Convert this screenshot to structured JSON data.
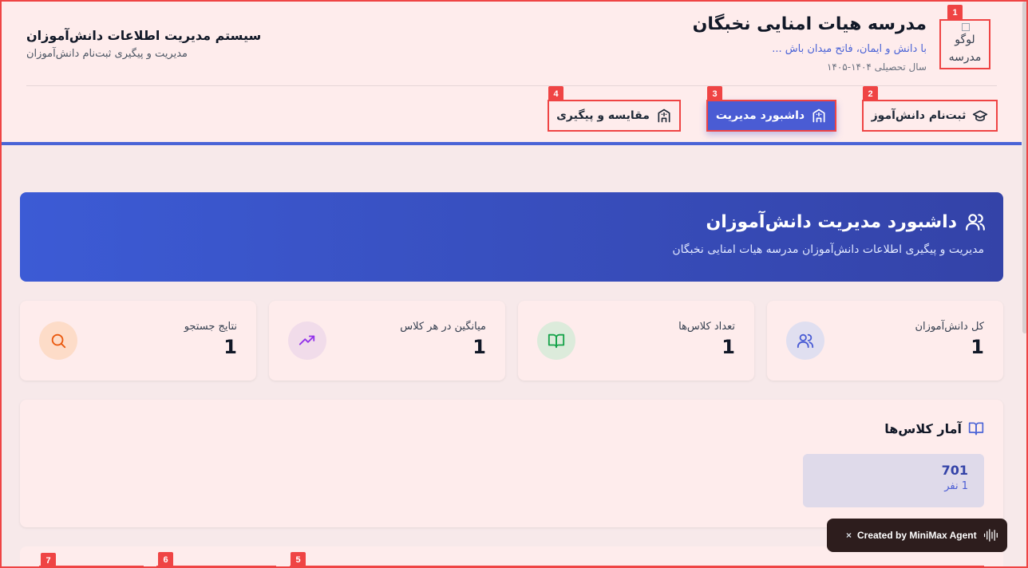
{
  "school": {
    "logo_alt": "لوگو مدرسه",
    "name": "مدرسه هیات امنایی نخبگان",
    "motto": "با دانش و ایمان، فاتح میدان باش ...",
    "year": "سال تحصیلی ۱۴۰۴-۱۴۰۵"
  },
  "system": {
    "title": "سیستم مدیریت اطلاعات دانش‌آموزان",
    "subtitle": "مدیریت و پیگیری ثبت‌نام دانش‌آموزان"
  },
  "nav": {
    "register": "ثبت‌نام دانش‌آموز",
    "dashboard": "داشبورد مدیریت",
    "compare": "مقایسه و پیگیری"
  },
  "banner": {
    "title": "داشبورد مدیریت دانش‌آموزان",
    "subtitle": "مدیریت و پیگیری اطلاعات دانش‌آموزان مدرسه هیات امنایی نخبگان"
  },
  "stats": [
    {
      "label": "کل دانش‌آموزان",
      "value": "1",
      "icon": "users-icon",
      "bg": "#e0dff0",
      "color": "#4a5cd4"
    },
    {
      "label": "تعداد کلاس‌ها",
      "value": "1",
      "icon": "book-open-icon",
      "bg": "#dcebdb",
      "color": "#16a34a"
    },
    {
      "label": "میانگین در هر کلاس",
      "value": "1",
      "icon": "trending-up-icon",
      "bg": "#f1dcea",
      "color": "#9333ea"
    },
    {
      "label": "نتایج جستجو",
      "value": "1",
      "icon": "search-icon",
      "bg": "#fddcc8",
      "color": "#ea580c"
    }
  ],
  "class_stats": {
    "title": "آمار کلاس‌ها",
    "classes": [
      {
        "number": "701",
        "count": "1 نفر"
      }
    ]
  },
  "markers": [
    "1",
    "2",
    "3",
    "4",
    "5",
    "6",
    "7"
  ],
  "badge": {
    "close": "×",
    "text": "Created by MiniMax Agent"
  }
}
